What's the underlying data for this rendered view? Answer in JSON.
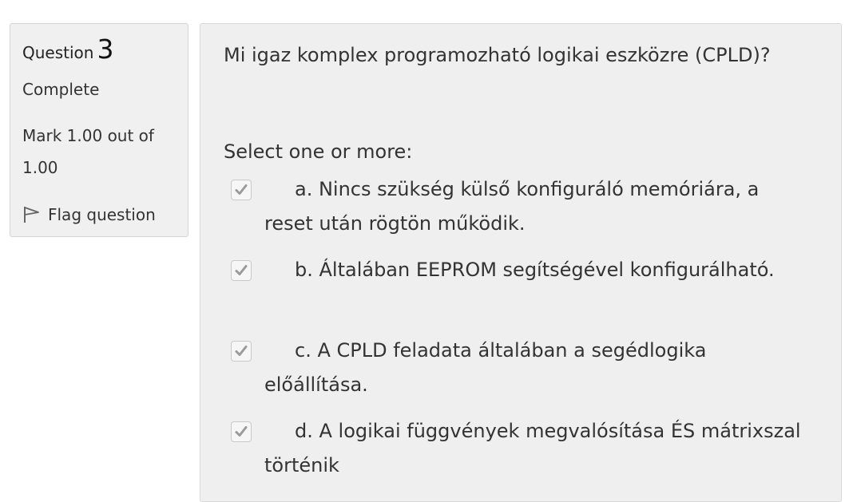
{
  "info": {
    "question_label": "Question",
    "question_number": "3",
    "state": "Complete",
    "grade": "Mark 1.00 out of 1.00",
    "flag_label": "Flag question"
  },
  "question": {
    "text": "Mi igaz komplex programozható logikai eszközre (CPLD)?",
    "prompt": "Select one or more:",
    "answers": [
      {
        "text": "a. Nincs szükség külső konfiguráló memóriára, a reset után rögtön működik.",
        "checked": true
      },
      {
        "text": "b. Általában EEPROM segítségével konfigurálható.",
        "checked": true
      },
      {
        "text": "c. A CPLD feladata általában a segédlogika előállítása.",
        "checked": true
      },
      {
        "text": "d. A logikai függvények megvalósítása ÉS mátrixszal történik",
        "checked": true
      }
    ]
  },
  "colors": {
    "panel_bg": "#f0f0f0",
    "content_bg": "#efefef",
    "checkmark": "#9a9a9a"
  }
}
